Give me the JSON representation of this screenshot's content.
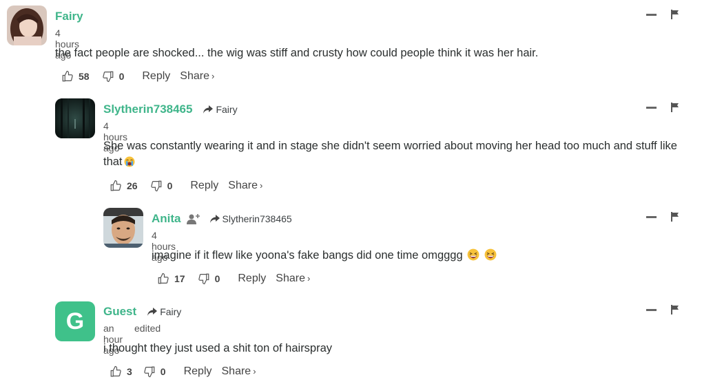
{
  "comments": [
    {
      "author": "Fairy",
      "reply_to": "",
      "time": "4 hours ago",
      "edited": "",
      "text": "the fact people are shocked... the wig was stiff and crusty how could people think it was her hair.",
      "likes": "58",
      "dislikes": "0",
      "reply_label": "Reply",
      "share_label": "Share",
      "avatar": "photo"
    },
    {
      "author": "Slytherin738465",
      "reply_to": "Fairy",
      "time": "4 hours ago",
      "edited": "",
      "text": "She was constantly wearing it and in stage she didn't seem worried about moving her head too much and stuff like that",
      "likes": "26",
      "dislikes": "0",
      "reply_label": "Reply",
      "share_label": "Share",
      "avatar": "photo"
    },
    {
      "author": "Anita",
      "reply_to": "Slytherin738465",
      "time": "4 hours ago",
      "edited": "",
      "text": "imagine if it flew like yoona's fake bangs did one time omgggg",
      "likes": "17",
      "dislikes": "0",
      "reply_label": "Reply",
      "share_label": "Share",
      "avatar": "photo"
    },
    {
      "author": "Guest",
      "reply_to": "Fairy",
      "time": "an hour ago",
      "edited": "edited",
      "text": "i thought they just used a shit ton of hairspray",
      "likes": "3",
      "dislikes": "0",
      "reply_label": "Reply",
      "share_label": "Share",
      "avatar_letter": "G"
    }
  ],
  "icons": {
    "like": "thumbs-up-icon",
    "dislike": "thumbs-down-icon",
    "collapse": "minus-icon",
    "report": "flag-icon",
    "reply_arrow": "reply-arrow-icon",
    "share_chevron": "›"
  },
  "colors": {
    "author": "#3fb58a",
    "guest_avatar": "#3fc18a",
    "text": "#2a2e2e"
  }
}
